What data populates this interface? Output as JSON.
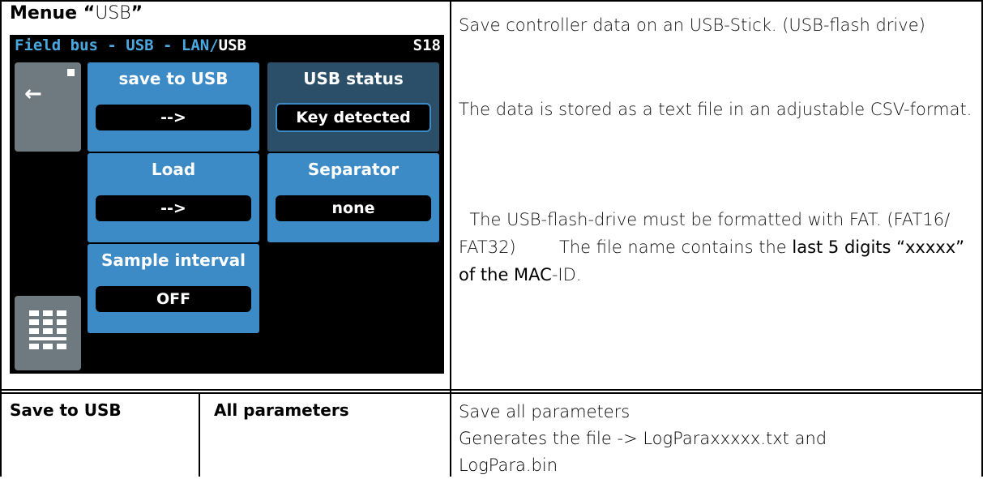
{
  "caption": {
    "bold_part": "Menue “",
    "light_part": "USB",
    "bold_end": "”"
  },
  "screen": {
    "path_prefix": "Field bus - USB - LAN/",
    "path_current": "USB",
    "screen_code": "S18",
    "back_icon": "←",
    "tiles": {
      "save_to_usb": {
        "title": "save to USB",
        "value": "-->"
      },
      "usb_status": {
        "title": "USB status",
        "value": "Key detected"
      },
      "load": {
        "title": "Load",
        "value": "-->"
      },
      "separator": {
        "title": "Separator",
        "value": "none"
      },
      "sample_interval": {
        "title": "Sample interval",
        "value": "OFF"
      }
    },
    "colors": {
      "tile_blue": "#3d8bc6",
      "tile_dark": "#2b4f68",
      "path_blue": "#4aa8e0",
      "button_gray": "#6f7a80"
    }
  },
  "description": {
    "p1": "Save controller data on an USB-Stick. (USB-flash drive)",
    "p2": "The data is stored as a text file in an adjustable CSV-format.",
    "p3_a": "The USB-flash-drive must be formatted with FAT. (FAT16/ FAT32)        The file name contains the ",
    "p3_b": "last 5 digits “xxxxx” of the MAC",
    "p3_c": "-ID."
  },
  "table_row": {
    "col1": "Save to USB",
    "col2": "All parameters",
    "desc_line1": "Save all parameters",
    "desc_line2": "Generates the file -> LogParaxxxxx.txt and",
    "desc_line3": "LogPara.bin"
  }
}
